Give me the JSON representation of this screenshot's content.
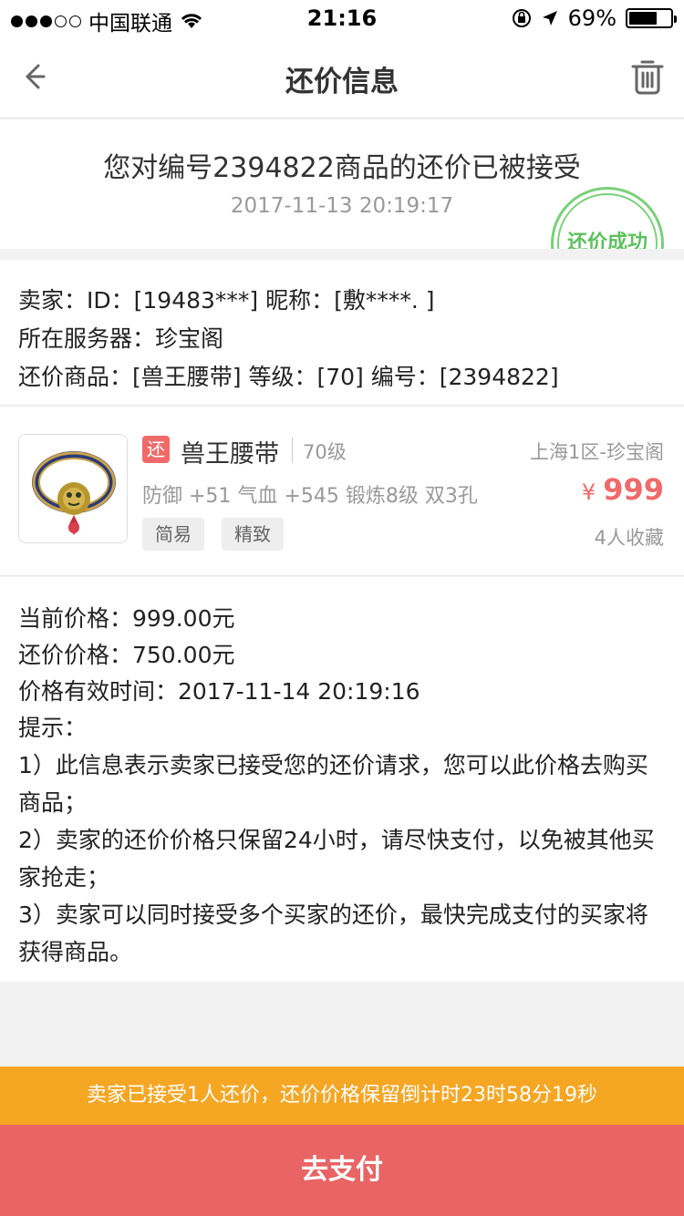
{
  "status_bar": {
    "carrier": "中国联通",
    "time": "21:16",
    "battery": "69%",
    "battery_level": 0.69
  },
  "nav": {
    "title": "还价信息"
  },
  "notice": {
    "title": "您对编号2394822商品的还价已被接受",
    "time": "2017-11-13 20:19:17",
    "stamp": "还价成功"
  },
  "seller": {
    "line1": "卖家：ID：[19483***] 昵称：[敷****.  ]",
    "line2": "所在服务器：珍宝阁",
    "line3": "还价商品：[兽王腰带] 等级：[70] 编号：[2394822]"
  },
  "product": {
    "badge": "还",
    "name": "兽王腰带",
    "level": "70级",
    "server": "上海1区-珍宝阁",
    "attrs": "防御 +51 气血 +545 锻炼8级 双3孔",
    "currency": "¥",
    "price": "999",
    "tags": [
      "简易",
      "精致"
    ],
    "favorites": "4人收藏"
  },
  "detail": {
    "current_price": "当前价格：999.00元",
    "offer_price": "还价价格：750.00元",
    "valid_until": "价格有效时间：2017-11-14 20:19:16",
    "tips_title": "提示：",
    "tip1": "1）此信息表示卖家已接受您的还价请求，您可以此价格去购买商品；",
    "tip2": "2）卖家的还价价格只保留24小时，请尽快支付，以免被其他买家抢走；",
    "tip3": "3）卖家可以同时接受多个买家的还价，最快完成支付的买家将获得商品。"
  },
  "bottom": {
    "countdown": "卖家已接受1人还价，还价价格保留倒计时23时58分19秒",
    "pay_label": "去支付"
  },
  "colors": {
    "accent_red": "#e96464",
    "countdown_orange": "#f5a623",
    "stamp_green": "#5cc25c"
  }
}
